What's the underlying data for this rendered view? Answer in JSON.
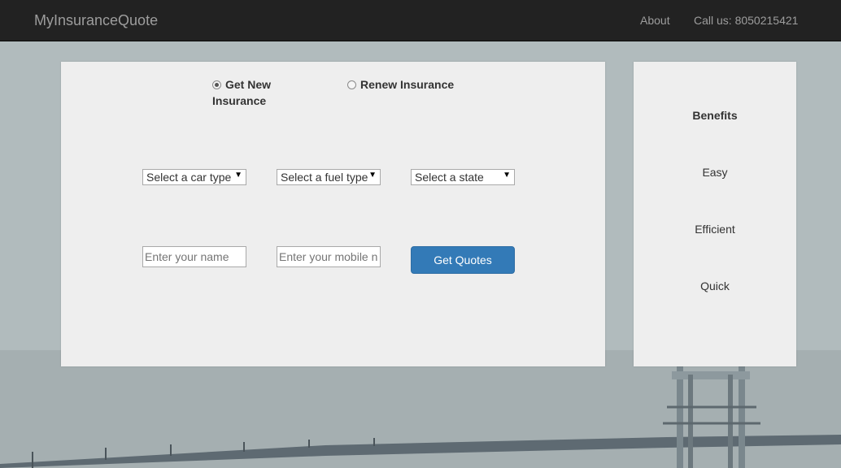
{
  "navbar": {
    "brand": "MyInsuranceQuote",
    "about": "About",
    "call": "Call us: 8050215421"
  },
  "form": {
    "radio_new_line1": "Get New",
    "radio_new_line2": "Insurance",
    "radio_renew": "Renew Insurance",
    "car_type": "Select a car type",
    "fuel_type": "Select a fuel type",
    "state": "Select a state",
    "name_placeholder": "Enter your name",
    "mobile_placeholder": "Enter your mobile number",
    "submit": "Get Quotes"
  },
  "benefits": {
    "title": "Benefits",
    "items": [
      "Easy",
      "Efficient",
      "Quick"
    ]
  }
}
